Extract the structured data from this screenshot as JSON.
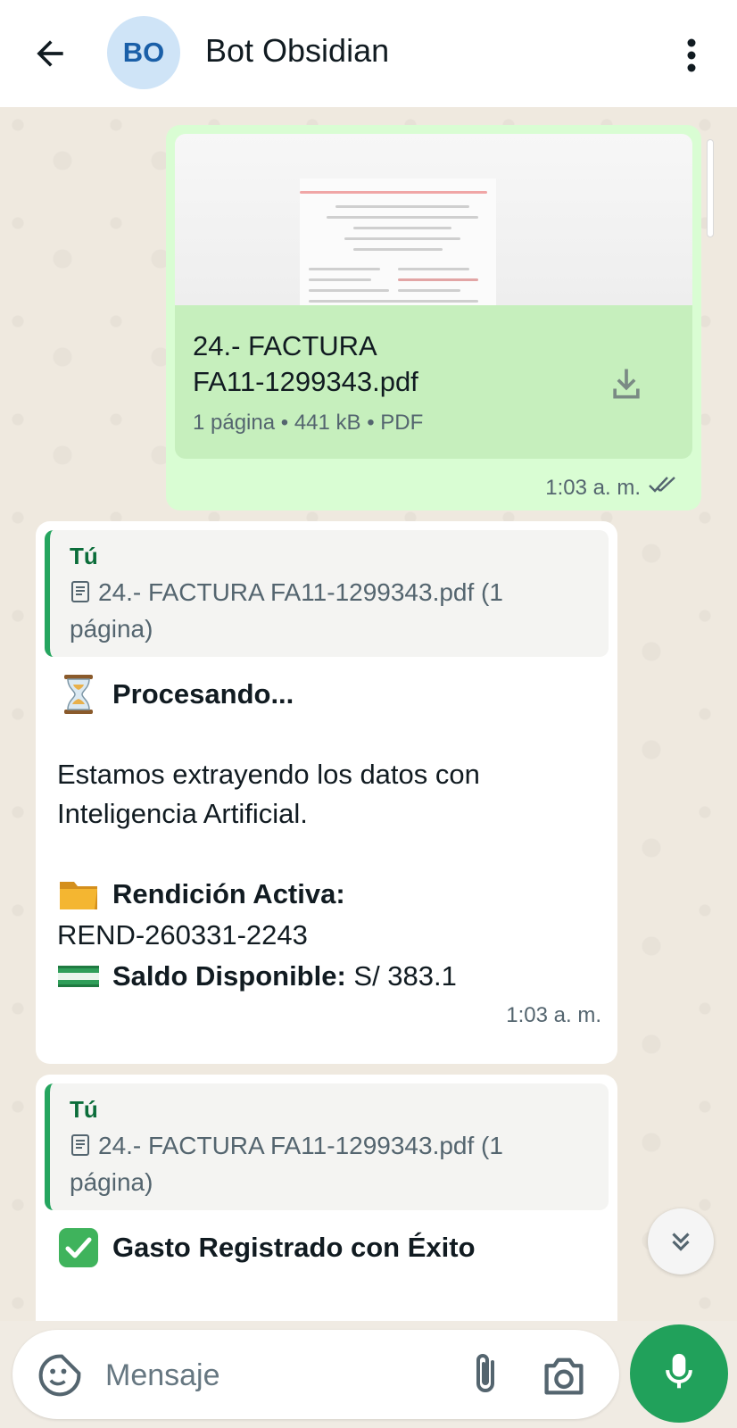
{
  "header": {
    "avatar_initials": "BO",
    "contact_name": "Bot Obsidian"
  },
  "outgoing_message": {
    "doc_name_line1": "24.- FACTURA",
    "doc_name_line2": "FA11-1299343.pdf",
    "doc_meta": "1 página • 441 kB • PDF",
    "time": "1:03 a. m.",
    "status": "read"
  },
  "incoming_messages": [
    {
      "quote_author": "Tú",
      "quote_text": "24.- FACTURA FA11-1299343.pdf (1 página)",
      "title": "Procesando...",
      "paragraph": "Estamos extrayendo los datos con Inteligencia Artificial.",
      "rendicion_label": "Rendición Activa:",
      "rendicion_value": "REND-260331-2243",
      "saldo_label": "Saldo Disponible:",
      "saldo_value": " S/ 383.1",
      "time": "1:03 a. m."
    },
    {
      "quote_author": "Tú",
      "quote_text": "24.- FACTURA FA11-1299343.pdf (1 página)",
      "title": "Gasto Registrado con Éxito"
    }
  ],
  "input": {
    "placeholder": "Mensaje"
  },
  "colors": {
    "accent": "#21a15b",
    "outgoing_bubble": "#d9fdd3",
    "incoming_bubble": "#ffffff",
    "quote_border": "#25a55f",
    "chat_background": "#efe9df"
  }
}
